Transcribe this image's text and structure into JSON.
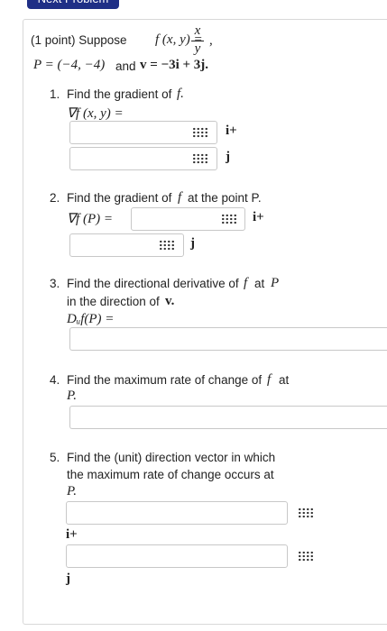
{
  "top_button": {
    "label": "Next Problem"
  },
  "problem": {
    "points": "(1 point) Suppose",
    "fn": "f (x, y) =",
    "numerator": "x",
    "denominator": "y",
    "comma": ",",
    "P_label": "P = (−4, −4)",
    "and": "and",
    "v_label": "v = −3i + 3j."
  },
  "parts": [
    {
      "number": "1.",
      "text": "Find the gradient of",
      "var": "f.",
      "lhs": "∇f (x, y) ="
    },
    {
      "number": "2.",
      "text": "Find the gradient of",
      "var": "f",
      "tail": "at the point P.",
      "lhs": "∇f (P) ="
    },
    {
      "number": "3.",
      "text": "Find the directional derivative of",
      "var": "f",
      "at": "at",
      "P": "P",
      "line2": "in the direction of",
      "v": "v.",
      "lhs": "Dᵤf(P) ="
    },
    {
      "number": "4.",
      "text": "Find the maximum rate of change of",
      "var": "f",
      "at": "at",
      "P": "P."
    },
    {
      "number": "5.",
      "line1": "Find the (unit) direction vector in which",
      "line2": "the maximum rate of change occurs at",
      "P": "P."
    }
  ],
  "units": {
    "i": "i+",
    "j": "j"
  }
}
